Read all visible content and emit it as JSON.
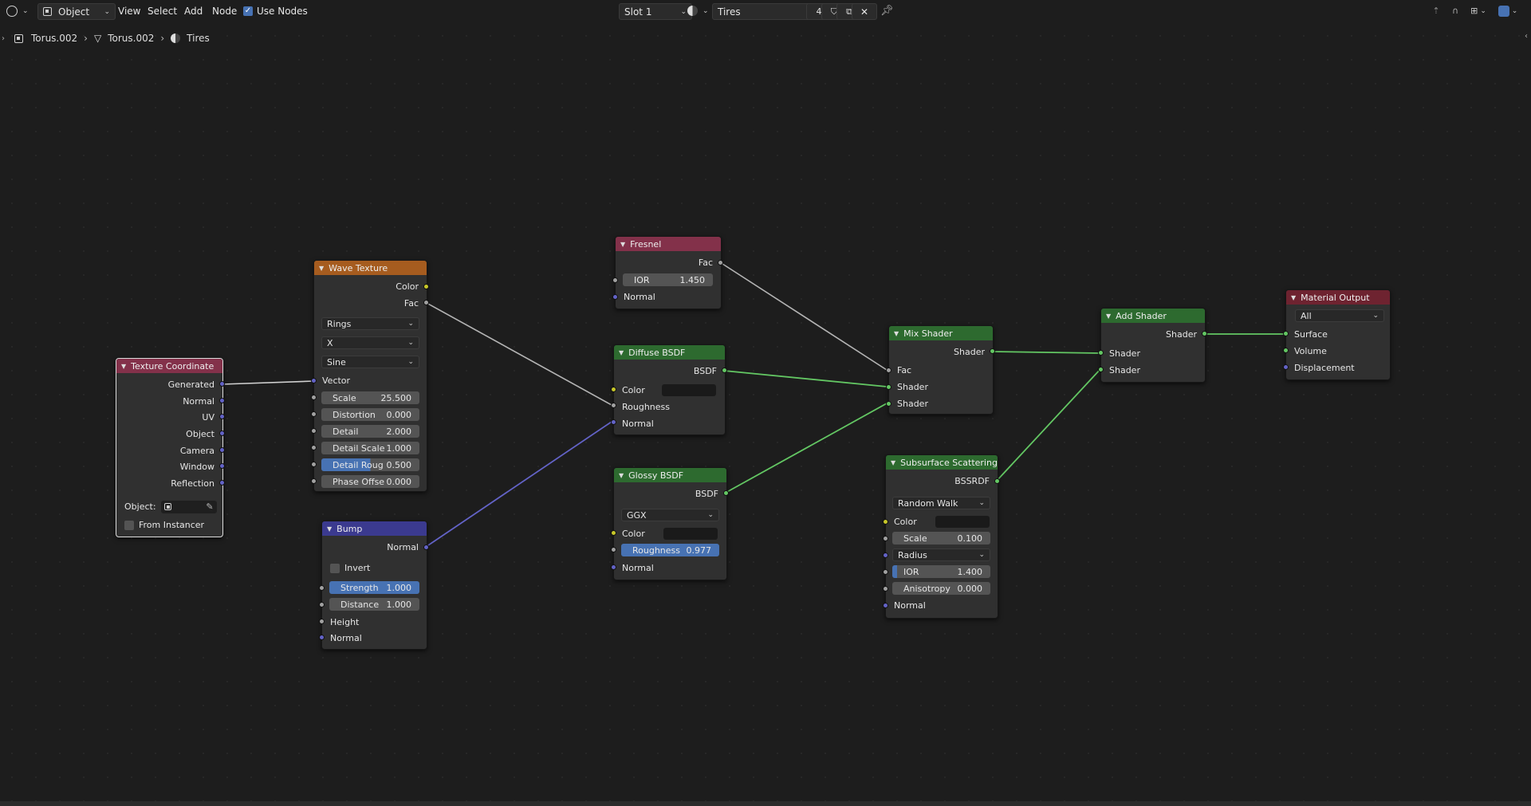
{
  "header": {
    "mode": "Object",
    "menus": [
      "View",
      "Select",
      "Add",
      "Node"
    ],
    "use_nodes_label": "Use Nodes",
    "slot": "Slot 1",
    "material": "Tires",
    "users": "4"
  },
  "breadcrumb": [
    "Torus.002",
    "Torus.002",
    "Tires"
  ],
  "nodes": {
    "texcoord": {
      "title": "Texture Coordinate",
      "outputs": [
        "Generated",
        "Normal",
        "UV",
        "Object",
        "Camera",
        "Window",
        "Reflection"
      ],
      "object_label": "Object:",
      "from_instancer": "From Instancer"
    },
    "wave": {
      "title": "Wave Texture",
      "outputs": [
        "Color",
        "Fac"
      ],
      "type": "Rings",
      "direction": "X",
      "profile": "Sine",
      "vector": "Vector",
      "fields": [
        [
          "Scale",
          "25.500"
        ],
        [
          "Distortion",
          "0.000"
        ],
        [
          "Detail",
          "2.000"
        ],
        [
          "Detail Scale",
          "1.000"
        ],
        [
          "Detail Roug",
          "0.500"
        ],
        [
          "Phase Offse",
          "0.000"
        ]
      ]
    },
    "bump": {
      "title": "Bump",
      "output": "Normal",
      "invert": "Invert",
      "strength": [
        "Strength",
        "1.000"
      ],
      "distance": [
        "Distance",
        "1.000"
      ],
      "inputs": [
        "Height",
        "Normal"
      ]
    },
    "fresnel": {
      "title": "Fresnel",
      "output": "Fac",
      "ior": [
        "IOR",
        "1.450"
      ],
      "normal": "Normal"
    },
    "diffuse": {
      "title": "Diffuse BSDF",
      "output": "BSDF",
      "inputs": [
        "Color",
        "Roughness",
        "Normal"
      ]
    },
    "glossy": {
      "title": "Glossy BSDF",
      "output": "BSDF",
      "distribution": "GGX",
      "color": "Color",
      "roughness": [
        "Roughness",
        "0.977"
      ],
      "normal": "Normal"
    },
    "mix": {
      "title": "Mix Shader",
      "output": "Shader",
      "inputs": [
        "Fac",
        "Shader",
        "Shader"
      ]
    },
    "sss": {
      "title": "Subsurface Scattering",
      "output": "BSSRDF",
      "method": "Random Walk",
      "color": "Color",
      "scale": [
        "Scale",
        "0.100"
      ],
      "radius": "Radius",
      "ior": [
        "IOR",
        "1.400"
      ],
      "anisotropy": [
        "Anisotropy",
        "0.000"
      ],
      "normal": "Normal"
    },
    "add": {
      "title": "Add Shader",
      "output": "Shader",
      "inputs": [
        "Shader",
        "Shader"
      ]
    },
    "output": {
      "title": "Material Output",
      "target": "All",
      "inputs": [
        "Surface",
        "Volume",
        "Displacement"
      ]
    }
  },
  "colors": {
    "input_header": "#83314a",
    "texture_header": "#a65c1f",
    "shader_header": "#2d6a2f",
    "vector_header": "#3b3a8f",
    "output_header": "#6e2330",
    "socket_shader": "#63c763",
    "socket_color": "#c7c729",
    "socket_float": "#a1a1a1",
    "socket_vector": "#6363c7"
  }
}
